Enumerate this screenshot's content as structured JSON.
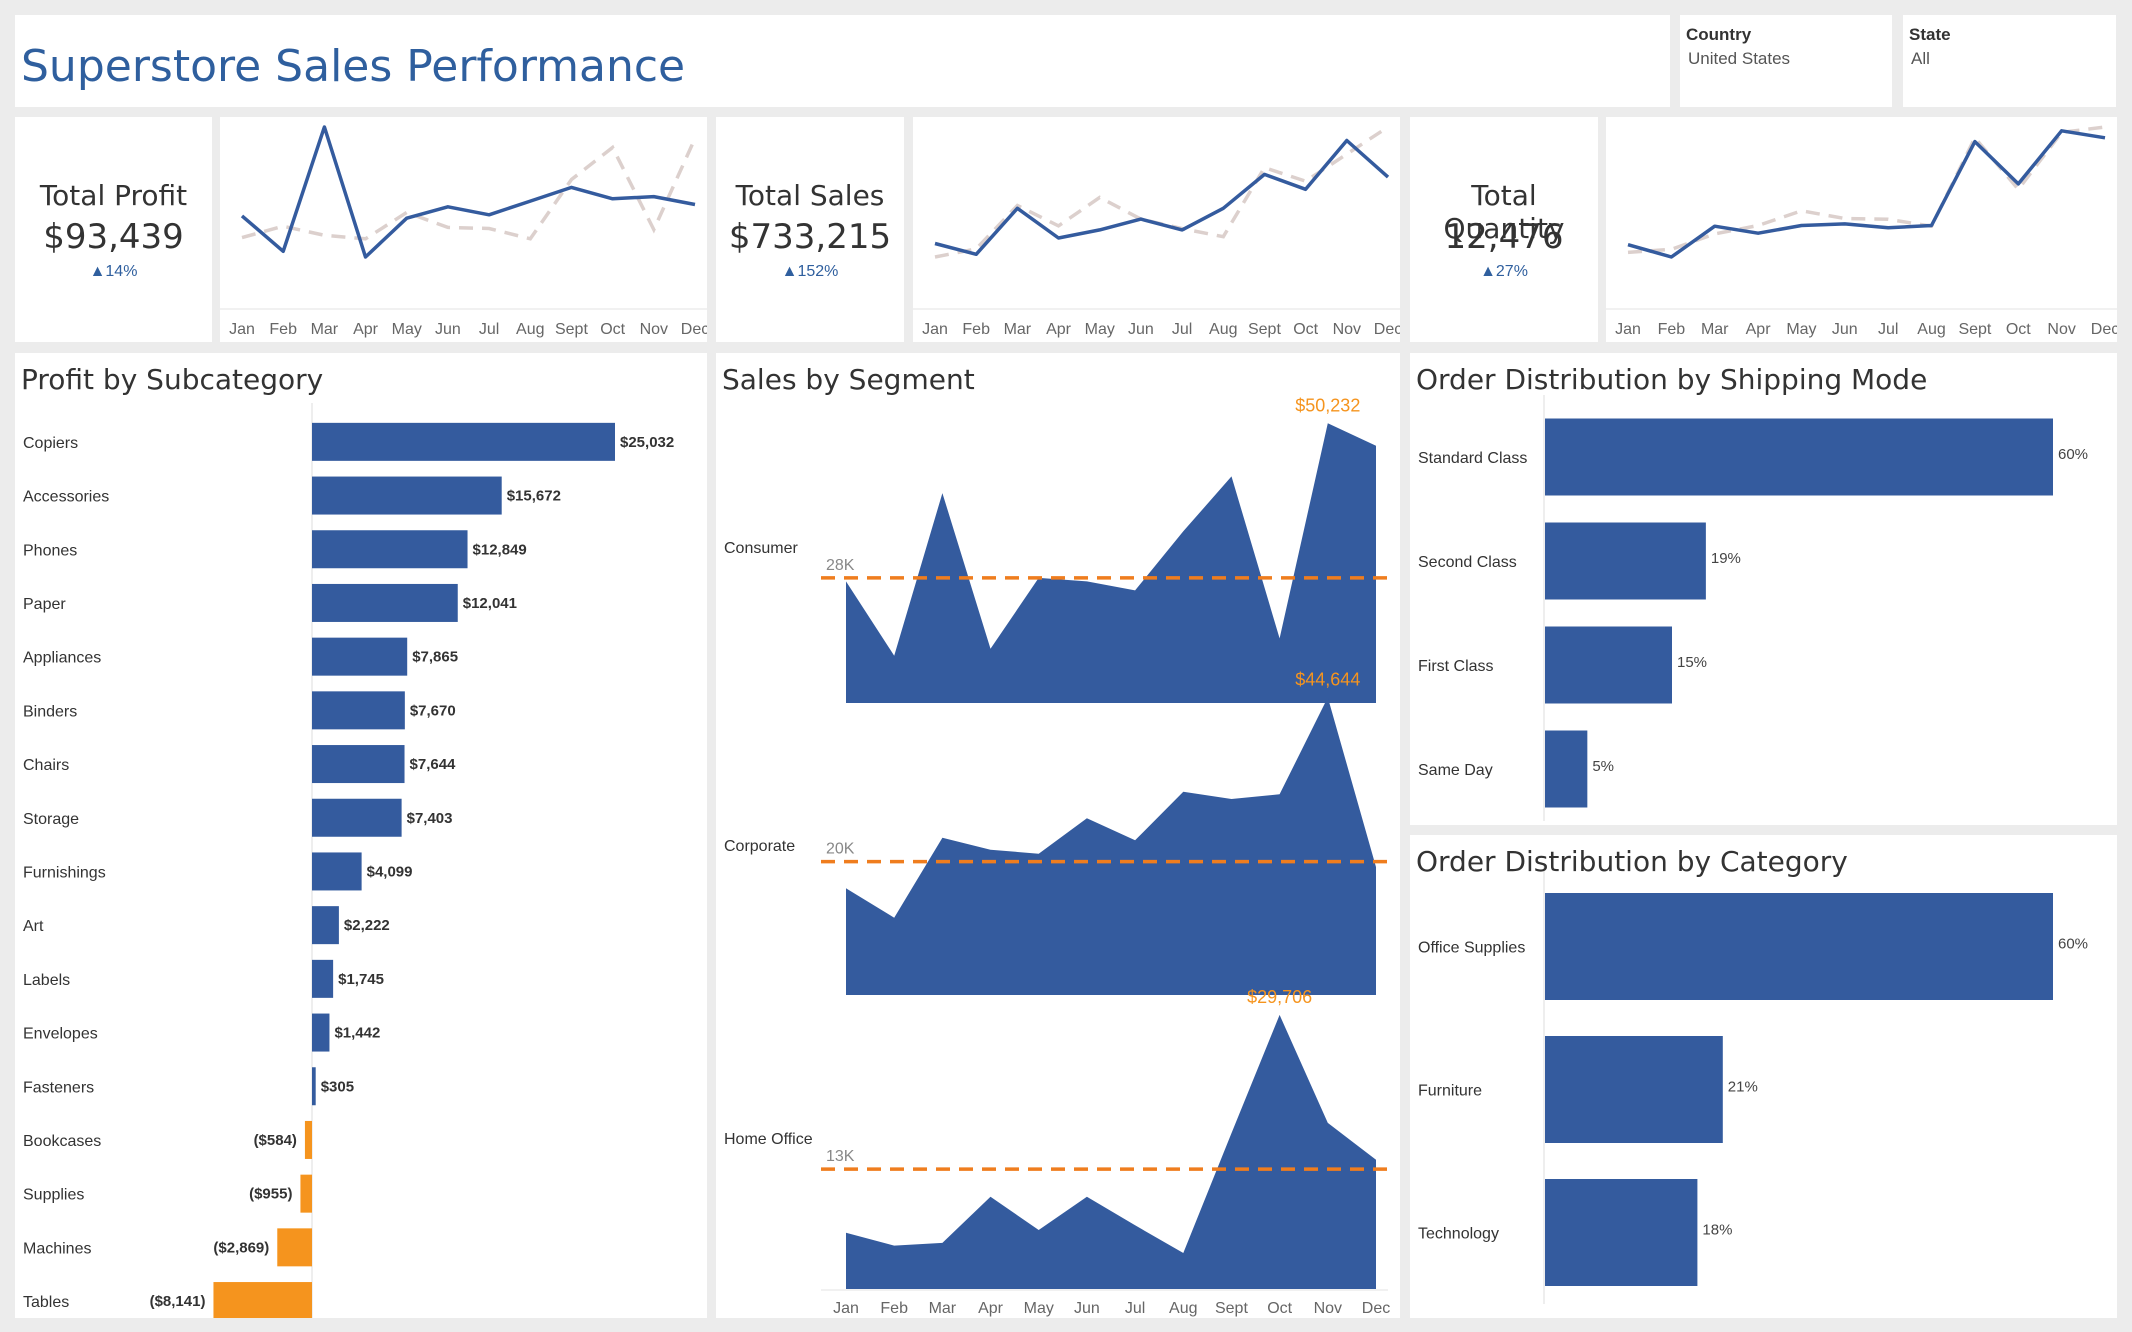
{
  "header": {
    "title": "Superstore Sales Performance"
  },
  "filters": [
    {
      "label": "Country",
      "value": "United States"
    },
    {
      "label": "State",
      "value": "All"
    }
  ],
  "colors": {
    "primary": "#345b9e",
    "negative": "#f5941e",
    "comparison": "#dcd0cd",
    "reference": "#ef7d1e",
    "title": "#2f5f9e"
  },
  "months": [
    "Jan",
    "Feb",
    "Mar",
    "Apr",
    "May",
    "Jun",
    "Jul",
    "Aug",
    "Sept",
    "Oct",
    "Nov",
    "Dec"
  ],
  "kpis": [
    {
      "label": "Total Profit",
      "value": "$93,439",
      "delta": "▲14%"
    },
    {
      "label": "Total Sales",
      "value": "$733,215",
      "delta": "▲152%"
    },
    {
      "label": "Total Quantity",
      "value": "12,476",
      "delta": "▲27%"
    }
  ],
  "sections": {
    "profit": "Profit by Subcategory",
    "segment": "Sales by Segment",
    "shipping": "Order Distribution by Shipping Mode",
    "category": "Order Distribution by Category"
  },
  "chart_data": [
    {
      "id": "profit-sparkline",
      "type": "line",
      "x": [
        "Jan",
        "Feb",
        "Mar",
        "Apr",
        "May",
        "Jun",
        "Jul",
        "Aug",
        "Sept",
        "Oct",
        "Nov",
        "Dec"
      ],
      "series": [
        {
          "role": "current",
          "values": [
            4200,
            1100,
            12000,
            600,
            4000,
            5000,
            4300,
            5500,
            6700,
            5700,
            5900,
            5200
          ]
        },
        {
          "role": "previous",
          "values": [
            2300,
            3300,
            2500,
            2200,
            4500,
            3200,
            3100,
            2200,
            7400,
            10200,
            3000,
            11000
          ]
        }
      ]
    },
    {
      "id": "sales-sparkline",
      "type": "line",
      "x": [
        "Jan",
        "Feb",
        "Mar",
        "Apr",
        "May",
        "Jun",
        "Jul",
        "Aug",
        "Sept",
        "Oct",
        "Nov",
        "Dec"
      ],
      "series": [
        {
          "role": "current",
          "values": [
            54000,
            46000,
            80000,
            58000,
            64000,
            72000,
            64000,
            80000,
            105000,
            94000,
            130000,
            103000
          ]
        },
        {
          "role": "previous",
          "values": [
            44000,
            50000,
            82000,
            67000,
            88000,
            72000,
            65000,
            59000,
            110000,
            100000,
            120000,
            140000
          ]
        }
      ]
    },
    {
      "id": "quantity-sparkline",
      "type": "line",
      "x": [
        "Jan",
        "Feb",
        "Mar",
        "Apr",
        "May",
        "Jun",
        "Jul",
        "Aug",
        "Sept",
        "Oct",
        "Nov",
        "Dec"
      ],
      "series": [
        {
          "role": "current",
          "values": [
            540,
            380,
            780,
            690,
            790,
            810,
            760,
            790,
            1880,
            1330,
            2020,
            1930
          ]
        },
        {
          "role": "previous",
          "values": [
            440,
            480,
            680,
            790,
            980,
            880,
            870,
            780,
            1930,
            1260,
            2000,
            2070
          ]
        }
      ]
    },
    {
      "id": "profit-by-subcategory",
      "type": "bar",
      "orientation": "horizontal",
      "categories": [
        "Copiers",
        "Accessories",
        "Phones",
        "Paper",
        "Appliances",
        "Binders",
        "Chairs",
        "Storage",
        "Furnishings",
        "Art",
        "Labels",
        "Envelopes",
        "Fasteners",
        "Bookcases",
        "Supplies",
        "Machines",
        "Tables"
      ],
      "values": [
        25032,
        15672,
        12849,
        12041,
        7865,
        7670,
        7644,
        7403,
        4099,
        2222,
        1745,
        1442,
        305,
        -584,
        -955,
        -2869,
        -8141
      ],
      "labels": [
        "$25,032",
        "$15,672",
        "$12,849",
        "$12,041",
        "$7,865",
        "$7,670",
        "$7,644",
        "$7,403",
        "$4,099",
        "$2,222",
        "$1,745",
        "$1,442",
        "$305",
        "($584)",
        "($955)",
        "($2,869)",
        "($8,141)"
      ]
    },
    {
      "id": "sales-by-segment",
      "type": "area",
      "x": [
        "Jan",
        "Feb",
        "Mar",
        "Apr",
        "May",
        "Jun",
        "Jul",
        "Aug",
        "Sept",
        "Oct",
        "Nov",
        "Dec"
      ],
      "series": [
        {
          "name": "Consumer",
          "values": [
            27500,
            16800,
            40200,
            17800,
            28000,
            27500,
            26200,
            34700,
            42600,
            19300,
            50232,
            47000
          ],
          "reference": 28000,
          "reference_label": "28K",
          "max_label": "$50,232",
          "max_index": 10,
          "ylim": [
            10000,
            51000
          ]
        },
        {
          "name": "Corporate",
          "values": [
            16000,
            11600,
            23600,
            21800,
            21200,
            26500,
            23200,
            30500,
            29400,
            30100,
            44644,
            19200
          ],
          "reference": 20000,
          "reference_label": "20K",
          "max_label": "$44,644",
          "max_index": 10,
          "ylim": [
            0,
            46500
          ]
        },
        {
          "name": "Home Office",
          "values": [
            6100,
            4700,
            5000,
            10000,
            6400,
            10000,
            6900,
            3900,
            16900,
            29706,
            18000,
            14000
          ],
          "reference": 13000,
          "reference_label": "13K",
          "max_label": "$29,706",
          "max_index": 9,
          "ylim": [
            0,
            31000
          ]
        }
      ]
    },
    {
      "id": "shipping-mode",
      "type": "bar",
      "orientation": "horizontal",
      "categories": [
        "Standard Class",
        "Second Class",
        "First Class",
        "Same Day"
      ],
      "values": [
        60,
        19,
        15,
        5
      ],
      "labels": [
        "60%",
        "19%",
        "15%",
        "5%"
      ]
    },
    {
      "id": "category",
      "type": "bar",
      "orientation": "horizontal",
      "categories": [
        "Office Supplies",
        "Furniture",
        "Technology"
      ],
      "values": [
        60,
        21,
        18
      ],
      "labels": [
        "60%",
        "21%",
        "18%"
      ]
    }
  ]
}
